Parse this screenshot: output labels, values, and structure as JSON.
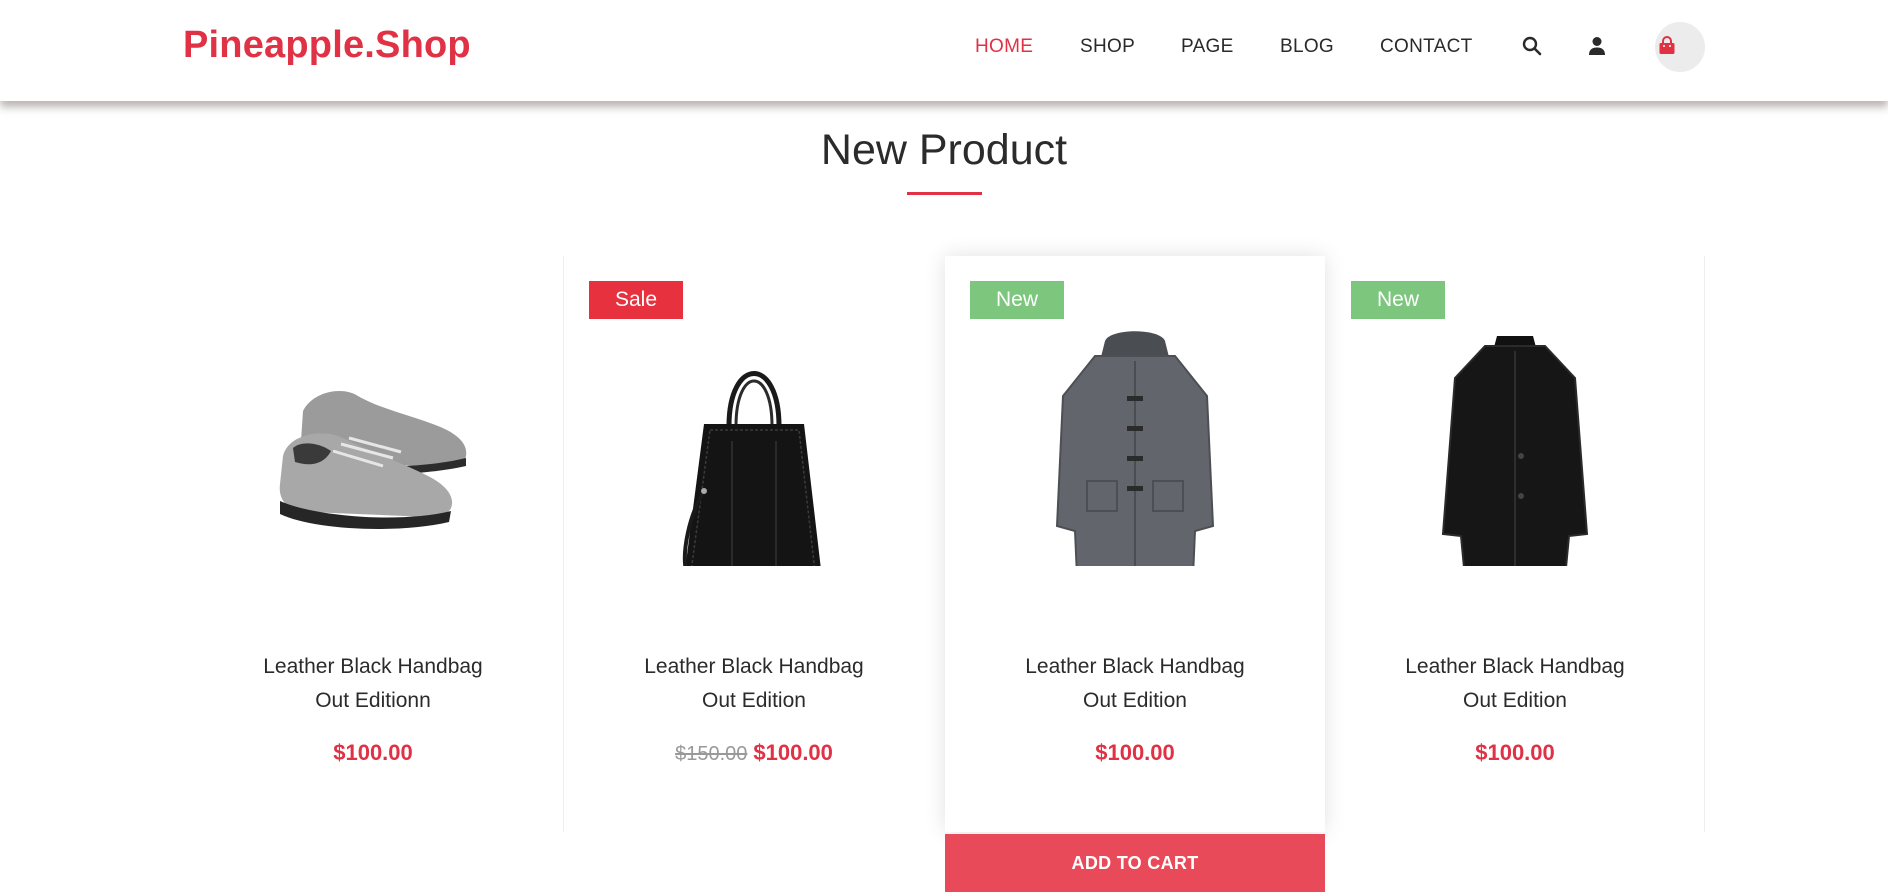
{
  "header": {
    "logo": "Pineapple.Shop",
    "nav": [
      "HOME",
      "SHOP",
      "PAGE",
      "BLOG",
      "CONTACT"
    ],
    "active_nav": "HOME",
    "icons": [
      "search-icon",
      "user-icon",
      "shopping-bag-icon"
    ]
  },
  "section": {
    "title": "New Product"
  },
  "products": [
    {
      "name_line1": "Leather Black Handbag",
      "name_line2": "Out Editionn",
      "badge": "",
      "old_price": "",
      "price": "$100.00"
    },
    {
      "name_line1": "Leather Black Handbag",
      "name_line2": "Out Edition",
      "badge": "Sale",
      "old_price": "$150.00",
      "price": "$100.00"
    },
    {
      "name_line1": "Leather Black Handbag",
      "name_line2": "Out Edition",
      "badge": "New",
      "old_price": "",
      "price": "$100.00"
    },
    {
      "name_line1": "Leather Black Handbag",
      "name_line2": "Out Edition",
      "badge": "New",
      "old_price": "",
      "price": "$100.00"
    }
  ],
  "add_to_cart_label": "ADD TO CART",
  "colors": {
    "accent": "#e03145",
    "sale_badge": "#e8313f",
    "new_badge": "#7dc67e",
    "add_to_cart_bg": "#e84a5a"
  }
}
